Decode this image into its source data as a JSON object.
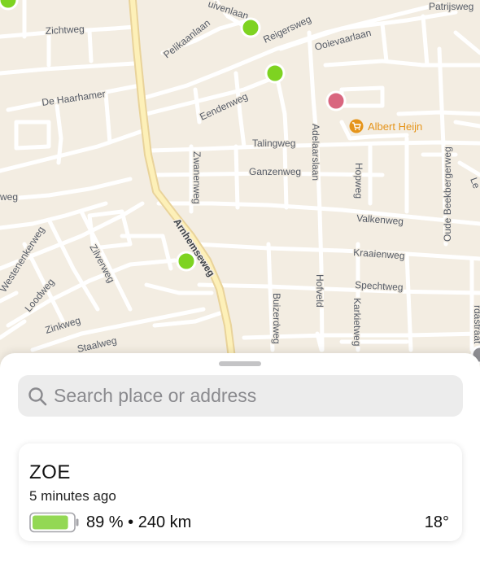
{
  "map": {
    "streets": {
      "zichtweg": "Zichtweg",
      "de_haarhamer": "De Haarhamer",
      "pelikaanlaan": "Pelikaanlaan",
      "duivenlaan": "uivenlaan",
      "reigersweg": "Reigersweg",
      "ooievaarlaan": "Ooievaarlaan",
      "patrijsweg": "Patrijsweg",
      "eendenweg": "Eendenweg",
      "talingweg": "Talingweg",
      "ganzenweg": "Ganzenweg",
      "zwanenweg": "Zwanenweg",
      "adelaarslaan": "Adelaarslaan",
      "hopweg": "Hopweg",
      "oude_beekbergerweg": "Oude Beekbergerweg",
      "valkenweg": "Valkenweg",
      "kraaienweg": "Kraaienweg",
      "spechtweg": "Spechtweg",
      "arnhemseweg": "Arnhemseweg",
      "weg_left": "weg",
      "westenenkerweg": "Westenenkerweg",
      "loodweg": "Loodweg",
      "zilverweg": "Zilverweg",
      "zinkweg": "Zinkweg",
      "staalweg": "Staalweg",
      "buizerdweg": "Buizerdweg",
      "hofveld": "Hofveld",
      "karkietweg": "Karkietweg",
      "rdastraat": "rdastraat",
      "le_fragment": "Le"
    },
    "poi": {
      "albert_heijn": "Albert Heijn",
      "icon": "shopping-cart-icon",
      "color": "#e5941a"
    },
    "markers": {
      "green_color": "#7ed321",
      "pink_color": "#d9667f"
    }
  },
  "sheet": {
    "search": {
      "placeholder": "Search place or address",
      "icon": "magnifier-icon"
    },
    "vehicle": {
      "name": "ZOE",
      "updated": "5 minutes ago",
      "battery_percent": 89,
      "battery_text": "89 % • 240 km",
      "temperature": "18°",
      "battery_color": "#93d854"
    }
  }
}
